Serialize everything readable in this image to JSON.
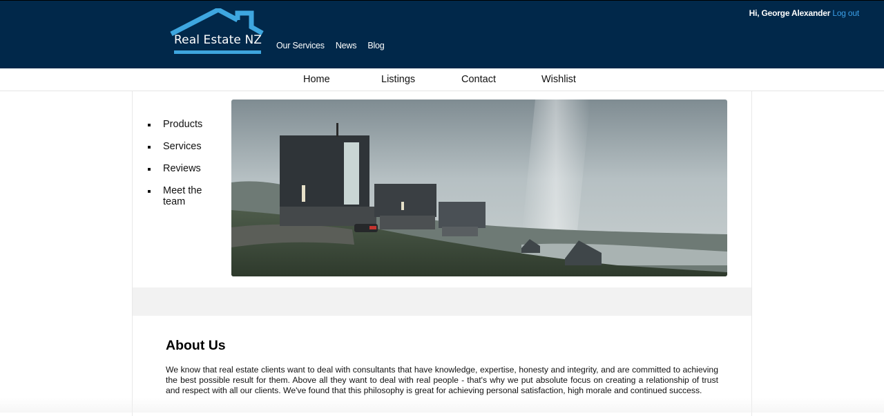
{
  "header": {
    "logo_text": "Real Estate NZ",
    "nav": [
      "Our Services",
      "News",
      "Blog"
    ],
    "greeting": "Hi, George Alexander",
    "logout_label": "Log out",
    "brand_color": "#01284a",
    "accent_color": "#3a9ee6"
  },
  "main_nav": {
    "items": [
      "Home",
      "Listings",
      "Contact",
      "Wishlist"
    ]
  },
  "sidebar": {
    "items": [
      "Products",
      "Services",
      "Reviews",
      "Meet the team"
    ]
  },
  "hero": {
    "icon": "landscape-houses-photo"
  },
  "about": {
    "title": "About Us",
    "text": "We know that real estate clients want to deal with consultants that have knowledge, expertise, honesty and integrity, and are committed to achieving the best possible result for them. Above all they want to deal with real people - that's why we put absolute focus on creating a relationship of trust and respect with all our clients. We've found that this philosophy is great for achieving personal satisfaction, high morale and continued success."
  }
}
